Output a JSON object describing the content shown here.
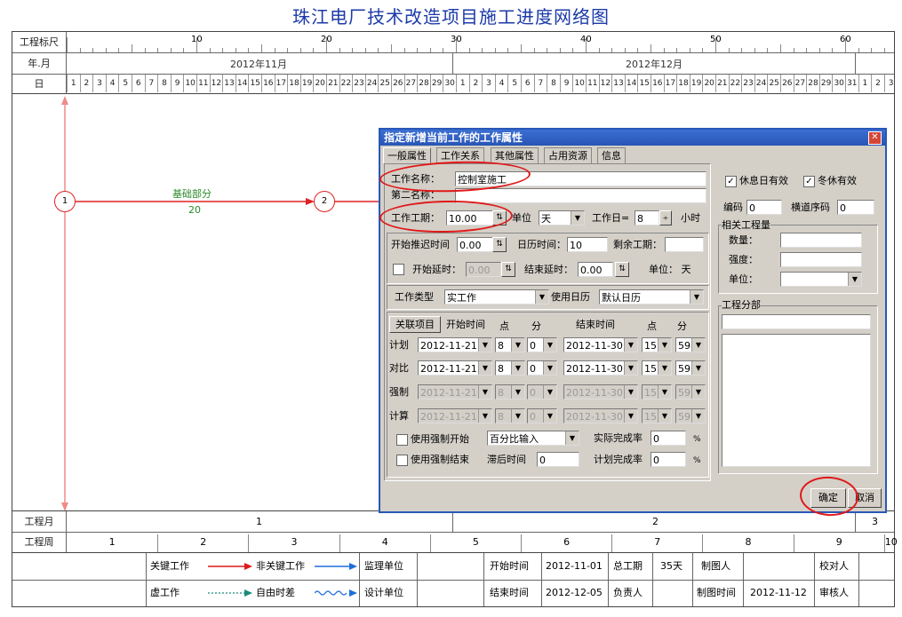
{
  "page_title": "珠江电厂技术改造项目施工进度网络图",
  "header": {
    "row_labels": [
      "工程标尺",
      "年.月",
      "日"
    ],
    "scale_ticks": [
      "10",
      "20",
      "30",
      "40",
      "50",
      "60"
    ],
    "months": [
      "2012年11月",
      "2012年12月"
    ],
    "days_nov": [
      "1",
      "2",
      "3",
      "4",
      "5",
      "6",
      "7",
      "8",
      "9",
      "10",
      "11",
      "12",
      "13",
      "14",
      "15",
      "16",
      "17",
      "18",
      "19",
      "20",
      "21",
      "22",
      "23",
      "24",
      "25",
      "26",
      "27",
      "28",
      "29",
      "30"
    ],
    "days_dec": [
      "1",
      "2",
      "3",
      "4",
      "5",
      "6",
      "7",
      "8",
      "9",
      "10",
      "11",
      "12",
      "13",
      "14",
      "15",
      "16",
      "17",
      "18",
      "19",
      "20",
      "21",
      "22",
      "23",
      "24",
      "25",
      "26",
      "27",
      "28",
      "29",
      "30",
      "31"
    ],
    "days_jan": [
      "1",
      "2",
      "3"
    ]
  },
  "network": {
    "node1": "1",
    "node2": "2",
    "activity_name": "基础部分",
    "activity_duration": "20"
  },
  "bottom": {
    "month_label": "工程月",
    "week_label": "工程周",
    "months": [
      "1",
      "2",
      "3"
    ],
    "weeks": [
      "1",
      "2",
      "3",
      "4",
      "5",
      "6",
      "7",
      "8",
      "9",
      "10"
    ]
  },
  "legend": {
    "critical": "关键工作",
    "noncritical": "非关键工作",
    "supervisor": "监理单位",
    "start_time_label": "开始时间",
    "start_time": "2012-11-01",
    "total_label": "总工期",
    "total": "35天",
    "drafter_label": "制图人",
    "checker_label": "校对人",
    "virtual": "虚工作",
    "free_float": "自由时差",
    "design": "设计单位",
    "end_time_label": "结束时间",
    "end_time": "2012-12-05",
    "owner_label": "负责人",
    "draw_time_label": "制图时间",
    "draw_time": "2012-11-12",
    "auditor_label": "审核人"
  },
  "dialog": {
    "title": "指定新增当前工作的工作属性",
    "close": "✕",
    "tabs": [
      "一般属性",
      "工作关系",
      "其他属性",
      "占用资源",
      "信息"
    ],
    "name_label": "工作名称：",
    "name_value": "控制室施工",
    "second_name_label": "第二名称：",
    "second_name_value": "",
    "duration_label": "工作工期：",
    "duration_value": "10.00",
    "unit_label": "单位",
    "unit_value": "天",
    "workday_label": "工作日=",
    "workday_value": "8",
    "hours_label": "小时",
    "start_delay_label": "开始推迟时间",
    "start_delay_value": "0.00",
    "calendar_time_label": "日历时间：",
    "calendar_time_value": "10",
    "remaining_label": "剩余工期：",
    "remaining_value": "",
    "start_lag_label": "开始延时：",
    "start_lag_value": "0.00",
    "end_lag_label": "结束延时：",
    "end_lag_value": "0.00",
    "lag_unit": "单位：  天",
    "type_label": "工作类型",
    "type_value": "实工作",
    "calendar_label": "使用日历",
    "calendar_value": "默认日历",
    "link_btn": "关联项目",
    "col_start": "开始时间",
    "col_hour": "点",
    "col_min": "分",
    "col_end": "结束时间",
    "col_hour2": "点",
    "col_min2": "分",
    "rows": [
      {
        "label": "计划",
        "start": "2012-11-21",
        "sh": "8",
        "sm": "0",
        "end": "2012-11-30",
        "eh": "15",
        "em": "59"
      },
      {
        "label": "对比",
        "start": "2012-11-21",
        "sh": "8",
        "sm": "0",
        "end": "2012-11-30",
        "eh": "15",
        "em": "59"
      },
      {
        "label": "强制",
        "start": "2012-11-21",
        "sh": "8",
        "sm": "0",
        "end": "2012-11-30",
        "eh": "15",
        "em": "59"
      },
      {
        "label": "计算",
        "start": "2012-11-21",
        "sh": "8",
        "sm": "0",
        "end": "2012-11-30",
        "eh": "15",
        "em": "59"
      }
    ],
    "force_start_label": "使用强制开始",
    "force_end_label": "使用强制结束",
    "percent_input": "百分比输入",
    "actual_label": "实际完成率",
    "actual_value": "0",
    "lag_after_label": "滞后时间",
    "lag_after_value": "0",
    "plan_label": "计划完成率",
    "plan_value": "0",
    "percent_sign": "%",
    "rest_valid": "休息日有效",
    "winter_valid": "冬休有效",
    "code_label": "编码",
    "code_value": "0",
    "lane_label": "横道序码",
    "lane_value": "0",
    "qty_group": "相关工程量",
    "qty_label": "数量：",
    "intensity_label": "强度：",
    "qty_unit_label": "单位：",
    "section_group": "工程分部",
    "ok": "确定",
    "cancel": "取消"
  }
}
